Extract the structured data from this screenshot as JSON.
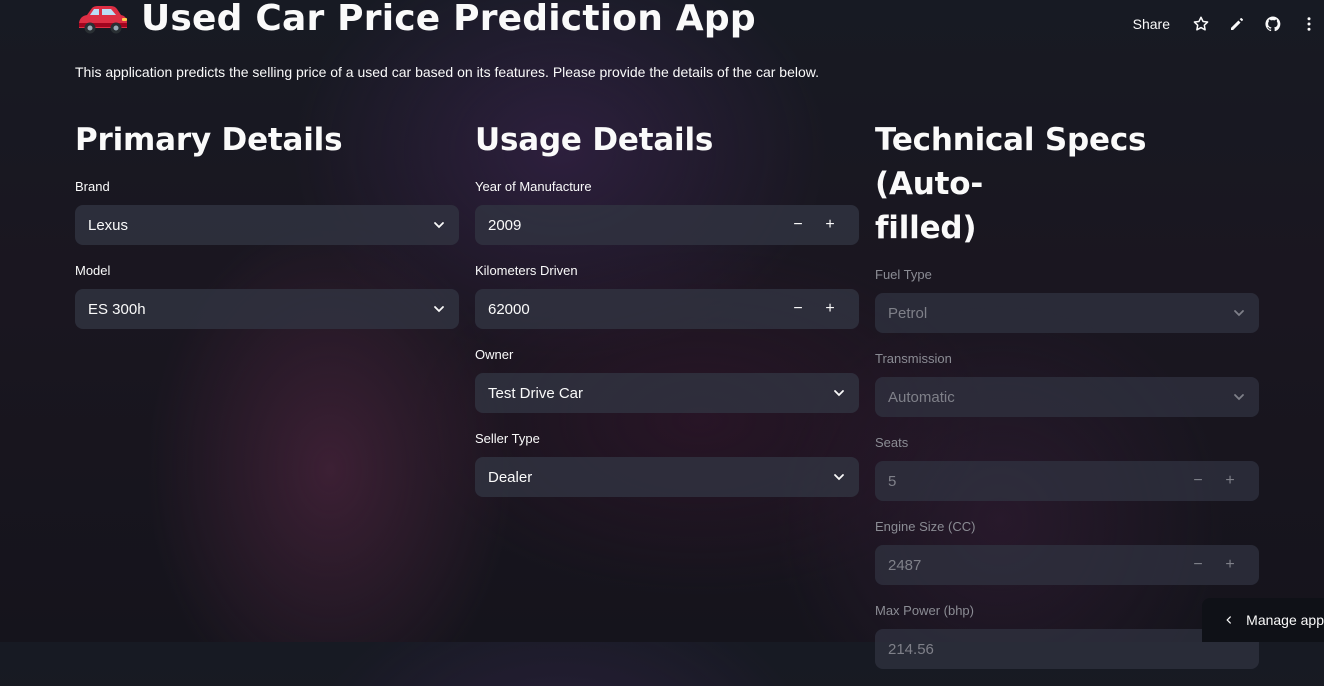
{
  "header": {
    "share_label": "Share",
    "icons": [
      "star-icon",
      "edit-pencil-icon",
      "github-icon",
      "more-vertical-icon"
    ]
  },
  "app": {
    "title_emoji_icon": "car-icon",
    "title": "Used Car Price Prediction App",
    "intro": "This application predicts the selling price of a used car based on its features. Please provide the details of the car below."
  },
  "primary": {
    "heading": "Primary Details",
    "brand": {
      "label": "Brand",
      "value": "Lexus"
    },
    "model": {
      "label": "Model",
      "value": "ES 300h"
    }
  },
  "usage": {
    "heading": "Usage Details",
    "year": {
      "label": "Year of Manufacture",
      "value": "2009"
    },
    "km": {
      "label": "Kilometers Driven",
      "value": "62000"
    },
    "owner": {
      "label": "Owner",
      "value": "Test Drive Car"
    },
    "seller": {
      "label": "Seller Type",
      "value": "Dealer"
    }
  },
  "tech": {
    "heading": "Technical Specs (Auto-filled)",
    "heading_line1": "Technical Specs (Auto-",
    "heading_line2": "filled)",
    "fuel": {
      "label": "Fuel Type",
      "value": "Petrol"
    },
    "transmission": {
      "label": "Transmission",
      "value": "Automatic"
    },
    "seats": {
      "label": "Seats",
      "value": "5"
    },
    "engine": {
      "label": "Engine Size (CC)",
      "value": "2487"
    },
    "power": {
      "label": "Max Power (bhp)",
      "value": "214.56"
    }
  },
  "stepper": {
    "minus": "−",
    "plus": "+"
  },
  "footer": {
    "manage_app_label": "Manage app"
  },
  "colors": {
    "background": "#171a23",
    "input_bg": "#313341",
    "text": "#fafafa",
    "muted": "#7f8089"
  }
}
